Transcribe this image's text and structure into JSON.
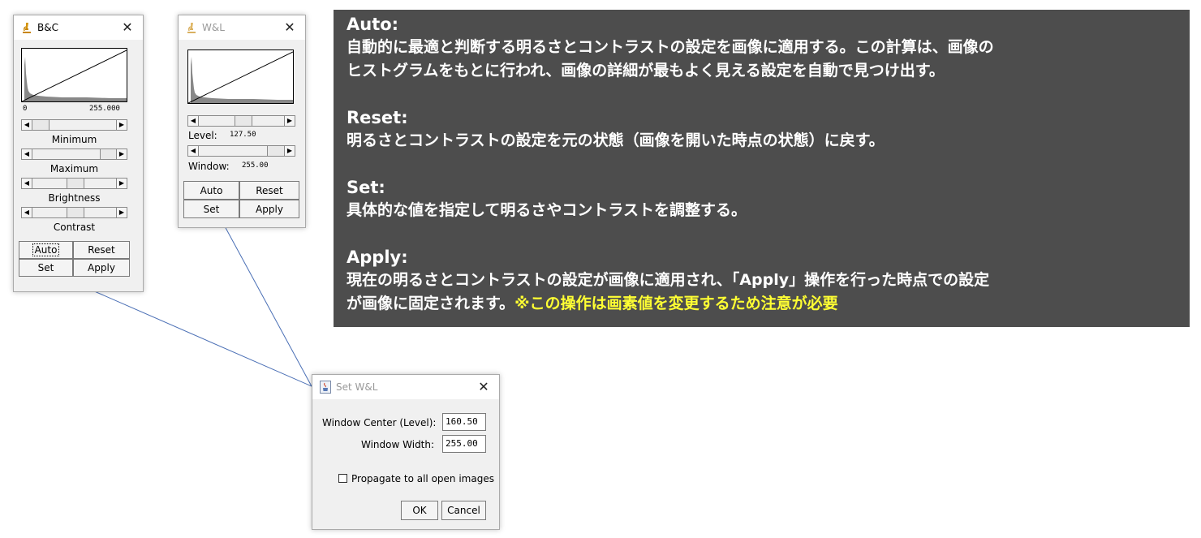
{
  "bc_window": {
    "title": "B&C",
    "close_glyph": "✕",
    "hist_min": "0",
    "hist_max": "255.000",
    "sliders": [
      {
        "label": "Minimum"
      },
      {
        "label": "Maximum"
      },
      {
        "label": "Brightness"
      },
      {
        "label": "Contrast"
      }
    ],
    "buttons": {
      "auto": "Auto",
      "reset": "Reset",
      "set": "Set",
      "apply": "Apply"
    }
  },
  "wl_window": {
    "title": "W&L",
    "close_glyph": "✕",
    "level_label": "Level:",
    "level_value": "127.50",
    "window_label": "Window:",
    "window_value": "255.00",
    "buttons": {
      "auto": "Auto",
      "reset": "Reset",
      "set": "Set",
      "apply": "Apply"
    }
  },
  "set_wl_dialog": {
    "title": "Set W&L",
    "close_glyph": "✕",
    "center_label": "Window Center (Level):",
    "center_value": "160.50",
    "width_label": "Window Width:",
    "width_value": "255.00",
    "propagate_label": "Propagate to all open images",
    "propagate_checked": false,
    "ok": "OK",
    "cancel": "Cancel"
  },
  "annotation": {
    "auto_title": "Auto:",
    "auto_line1": "自動的に最適と判断する明るさとコントラストの設定を画像に適用する。この計算は、画像の",
    "auto_line2": "ヒストグラムをもとに行われ、画像の詳細が最もよく見える設定を自動で見つけ出す。",
    "reset_title": "Reset:",
    "reset_line1": "明るさとコントラストの設定を元の状態（画像を開いた時点の状態）に戻す。",
    "set_title": "Set:",
    "set_line1": "具体的な値を指定して明るさやコントラストを調整する。",
    "apply_title": "Apply:",
    "apply_line1": "現在の明るさとコントラストの設定が画像に適用され、「Apply」操作を行った時点での設定",
    "apply_line2": "が画像に固定されます。",
    "apply_warning": "※この操作は画素値を変更するため注意が必要",
    "warning_color": "#ffff33",
    "panel_color": "#4d4d4d"
  },
  "icons": {
    "app_icon": "microscope-icon",
    "dialog_icon": "java-cup-icon"
  }
}
